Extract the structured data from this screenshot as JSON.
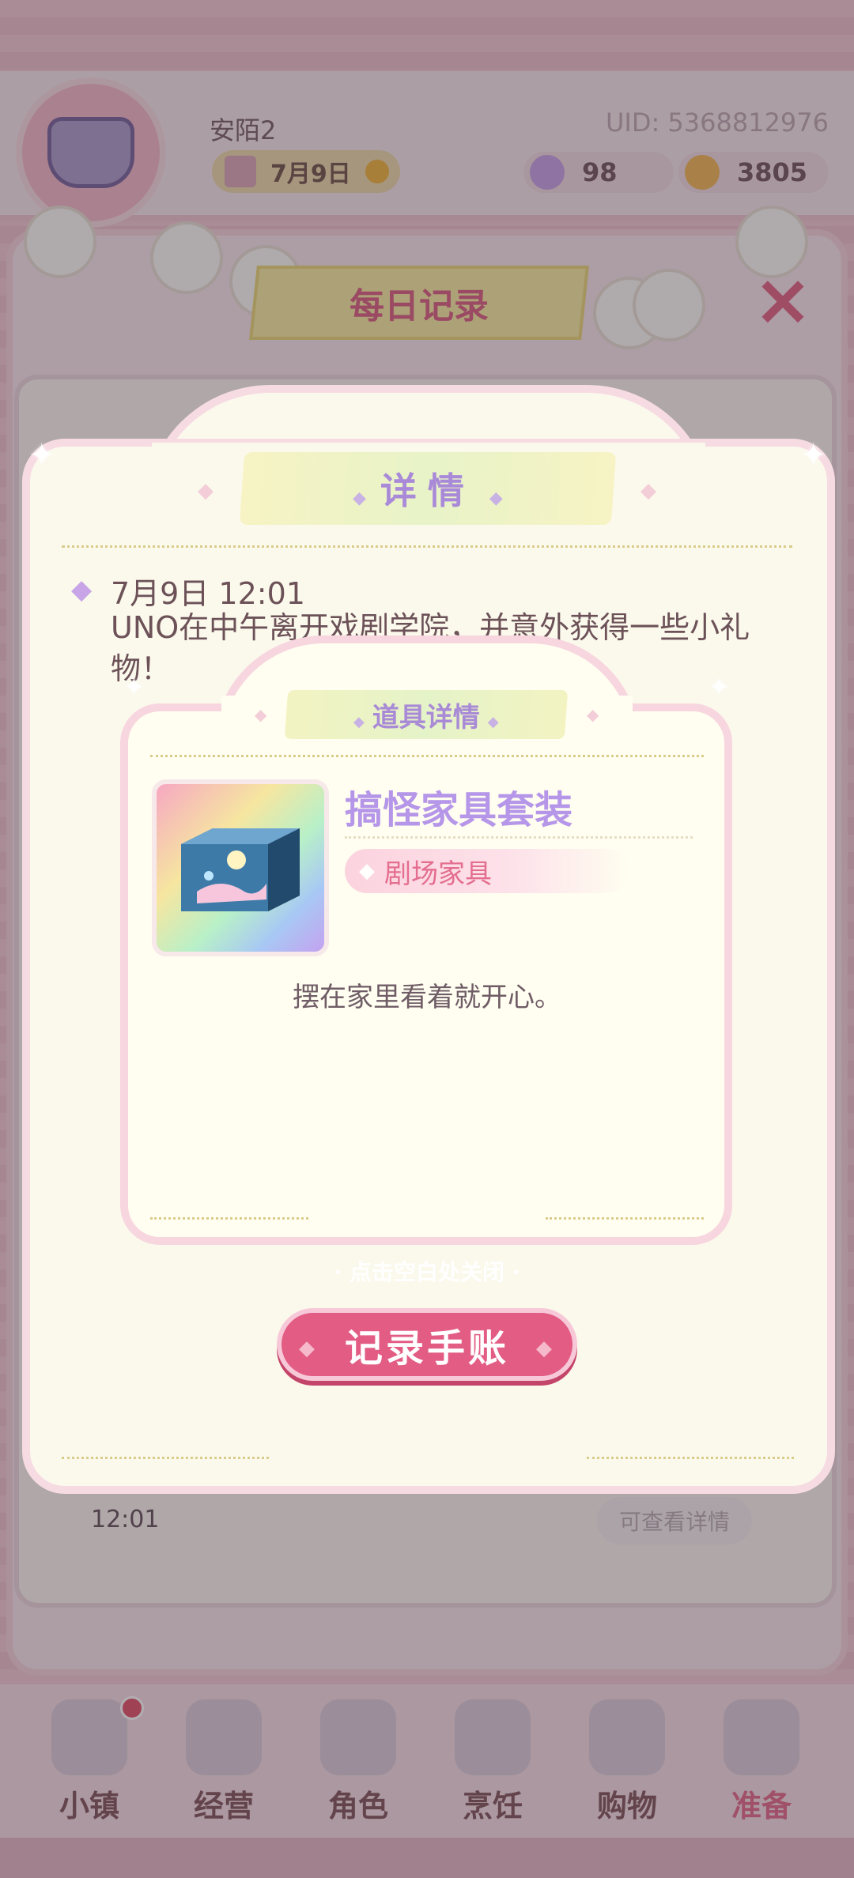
{
  "player": {
    "name": "安陌2",
    "uid": "UID: 5368812976",
    "date": "7月9日",
    "gems": "98",
    "coins": "3805"
  },
  "record_panel": {
    "title": "每日记录",
    "entry_time": "12:01",
    "view_details_label": "可查看详情"
  },
  "details_popup": {
    "title": "详情",
    "entry_datetime": "7月9日 12:01",
    "entry_text": "UNO在中午离开戏剧学院，并意外获得一些小礼物！",
    "close_hint": "· 点击空白处关闭 ·",
    "record_button_label": "记录手账"
  },
  "item_popup": {
    "title": "道具详情",
    "item_name": "搞怪家具套装",
    "item_category": "剧场家具",
    "item_description": "摆在家里看着就开心。",
    "item_icon": "blue-gift-box-icon"
  },
  "nav": {
    "items": [
      {
        "label": "小镇",
        "icon": "town-map-icon"
      },
      {
        "label": "经营",
        "icon": "shop-lock-icon"
      },
      {
        "label": "角色",
        "icon": "character-icon"
      },
      {
        "label": "烹饪",
        "icon": "cake-icon"
      },
      {
        "label": "购物",
        "icon": "shopping-bag-icon"
      },
      {
        "label": "准备",
        "icon": "basket-icon"
      }
    ]
  },
  "colors": {
    "accent_pink": "#e25c84",
    "title_purple": "#a98ad8",
    "popup_bg": "#fbf9ec"
  }
}
